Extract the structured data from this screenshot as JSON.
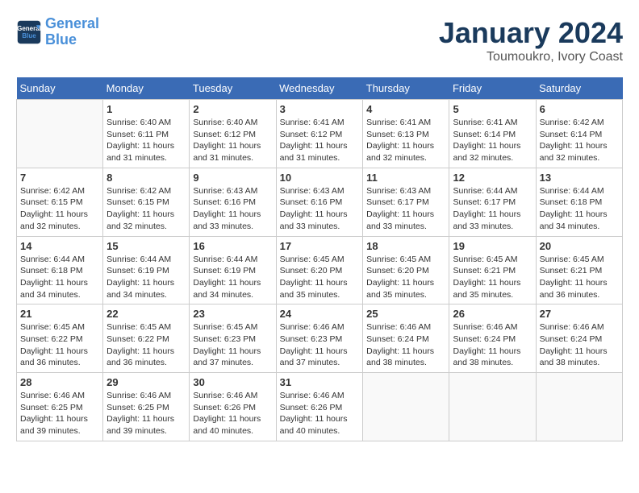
{
  "header": {
    "logo_line1": "General",
    "logo_line2": "Blue",
    "month": "January 2024",
    "location": "Toumoukro, Ivory Coast"
  },
  "weekdays": [
    "Sunday",
    "Monday",
    "Tuesday",
    "Wednesday",
    "Thursday",
    "Friday",
    "Saturday"
  ],
  "weeks": [
    [
      {
        "day": "",
        "sunrise": "",
        "sunset": "",
        "daylight": ""
      },
      {
        "day": "1",
        "sunrise": "Sunrise: 6:40 AM",
        "sunset": "Sunset: 6:11 PM",
        "daylight": "Daylight: 11 hours and 31 minutes."
      },
      {
        "day": "2",
        "sunrise": "Sunrise: 6:40 AM",
        "sunset": "Sunset: 6:12 PM",
        "daylight": "Daylight: 11 hours and 31 minutes."
      },
      {
        "day": "3",
        "sunrise": "Sunrise: 6:41 AM",
        "sunset": "Sunset: 6:12 PM",
        "daylight": "Daylight: 11 hours and 31 minutes."
      },
      {
        "day": "4",
        "sunrise": "Sunrise: 6:41 AM",
        "sunset": "Sunset: 6:13 PM",
        "daylight": "Daylight: 11 hours and 32 minutes."
      },
      {
        "day": "5",
        "sunrise": "Sunrise: 6:41 AM",
        "sunset": "Sunset: 6:14 PM",
        "daylight": "Daylight: 11 hours and 32 minutes."
      },
      {
        "day": "6",
        "sunrise": "Sunrise: 6:42 AM",
        "sunset": "Sunset: 6:14 PM",
        "daylight": "Daylight: 11 hours and 32 minutes."
      }
    ],
    [
      {
        "day": "7",
        "sunrise": "Sunrise: 6:42 AM",
        "sunset": "Sunset: 6:15 PM",
        "daylight": "Daylight: 11 hours and 32 minutes."
      },
      {
        "day": "8",
        "sunrise": "Sunrise: 6:42 AM",
        "sunset": "Sunset: 6:15 PM",
        "daylight": "Daylight: 11 hours and 32 minutes."
      },
      {
        "day": "9",
        "sunrise": "Sunrise: 6:43 AM",
        "sunset": "Sunset: 6:16 PM",
        "daylight": "Daylight: 11 hours and 33 minutes."
      },
      {
        "day": "10",
        "sunrise": "Sunrise: 6:43 AM",
        "sunset": "Sunset: 6:16 PM",
        "daylight": "Daylight: 11 hours and 33 minutes."
      },
      {
        "day": "11",
        "sunrise": "Sunrise: 6:43 AM",
        "sunset": "Sunset: 6:17 PM",
        "daylight": "Daylight: 11 hours and 33 minutes."
      },
      {
        "day": "12",
        "sunrise": "Sunrise: 6:44 AM",
        "sunset": "Sunset: 6:17 PM",
        "daylight": "Daylight: 11 hours and 33 minutes."
      },
      {
        "day": "13",
        "sunrise": "Sunrise: 6:44 AM",
        "sunset": "Sunset: 6:18 PM",
        "daylight": "Daylight: 11 hours and 34 minutes."
      }
    ],
    [
      {
        "day": "14",
        "sunrise": "Sunrise: 6:44 AM",
        "sunset": "Sunset: 6:18 PM",
        "daylight": "Daylight: 11 hours and 34 minutes."
      },
      {
        "day": "15",
        "sunrise": "Sunrise: 6:44 AM",
        "sunset": "Sunset: 6:19 PM",
        "daylight": "Daylight: 11 hours and 34 minutes."
      },
      {
        "day": "16",
        "sunrise": "Sunrise: 6:44 AM",
        "sunset": "Sunset: 6:19 PM",
        "daylight": "Daylight: 11 hours and 34 minutes."
      },
      {
        "day": "17",
        "sunrise": "Sunrise: 6:45 AM",
        "sunset": "Sunset: 6:20 PM",
        "daylight": "Daylight: 11 hours and 35 minutes."
      },
      {
        "day": "18",
        "sunrise": "Sunrise: 6:45 AM",
        "sunset": "Sunset: 6:20 PM",
        "daylight": "Daylight: 11 hours and 35 minutes."
      },
      {
        "day": "19",
        "sunrise": "Sunrise: 6:45 AM",
        "sunset": "Sunset: 6:21 PM",
        "daylight": "Daylight: 11 hours and 35 minutes."
      },
      {
        "day": "20",
        "sunrise": "Sunrise: 6:45 AM",
        "sunset": "Sunset: 6:21 PM",
        "daylight": "Daylight: 11 hours and 36 minutes."
      }
    ],
    [
      {
        "day": "21",
        "sunrise": "Sunrise: 6:45 AM",
        "sunset": "Sunset: 6:22 PM",
        "daylight": "Daylight: 11 hours and 36 minutes."
      },
      {
        "day": "22",
        "sunrise": "Sunrise: 6:45 AM",
        "sunset": "Sunset: 6:22 PM",
        "daylight": "Daylight: 11 hours and 36 minutes."
      },
      {
        "day": "23",
        "sunrise": "Sunrise: 6:45 AM",
        "sunset": "Sunset: 6:23 PM",
        "daylight": "Daylight: 11 hours and 37 minutes."
      },
      {
        "day": "24",
        "sunrise": "Sunrise: 6:46 AM",
        "sunset": "Sunset: 6:23 PM",
        "daylight": "Daylight: 11 hours and 37 minutes."
      },
      {
        "day": "25",
        "sunrise": "Sunrise: 6:46 AM",
        "sunset": "Sunset: 6:24 PM",
        "daylight": "Daylight: 11 hours and 38 minutes."
      },
      {
        "day": "26",
        "sunrise": "Sunrise: 6:46 AM",
        "sunset": "Sunset: 6:24 PM",
        "daylight": "Daylight: 11 hours and 38 minutes."
      },
      {
        "day": "27",
        "sunrise": "Sunrise: 6:46 AM",
        "sunset": "Sunset: 6:24 PM",
        "daylight": "Daylight: 11 hours and 38 minutes."
      }
    ],
    [
      {
        "day": "28",
        "sunrise": "Sunrise: 6:46 AM",
        "sunset": "Sunset: 6:25 PM",
        "daylight": "Daylight: 11 hours and 39 minutes."
      },
      {
        "day": "29",
        "sunrise": "Sunrise: 6:46 AM",
        "sunset": "Sunset: 6:25 PM",
        "daylight": "Daylight: 11 hours and 39 minutes."
      },
      {
        "day": "30",
        "sunrise": "Sunrise: 6:46 AM",
        "sunset": "Sunset: 6:26 PM",
        "daylight": "Daylight: 11 hours and 40 minutes."
      },
      {
        "day": "31",
        "sunrise": "Sunrise: 6:46 AM",
        "sunset": "Sunset: 6:26 PM",
        "daylight": "Daylight: 11 hours and 40 minutes."
      },
      {
        "day": "",
        "sunrise": "",
        "sunset": "",
        "daylight": ""
      },
      {
        "day": "",
        "sunrise": "",
        "sunset": "",
        "daylight": ""
      },
      {
        "day": "",
        "sunrise": "",
        "sunset": "",
        "daylight": ""
      }
    ]
  ]
}
